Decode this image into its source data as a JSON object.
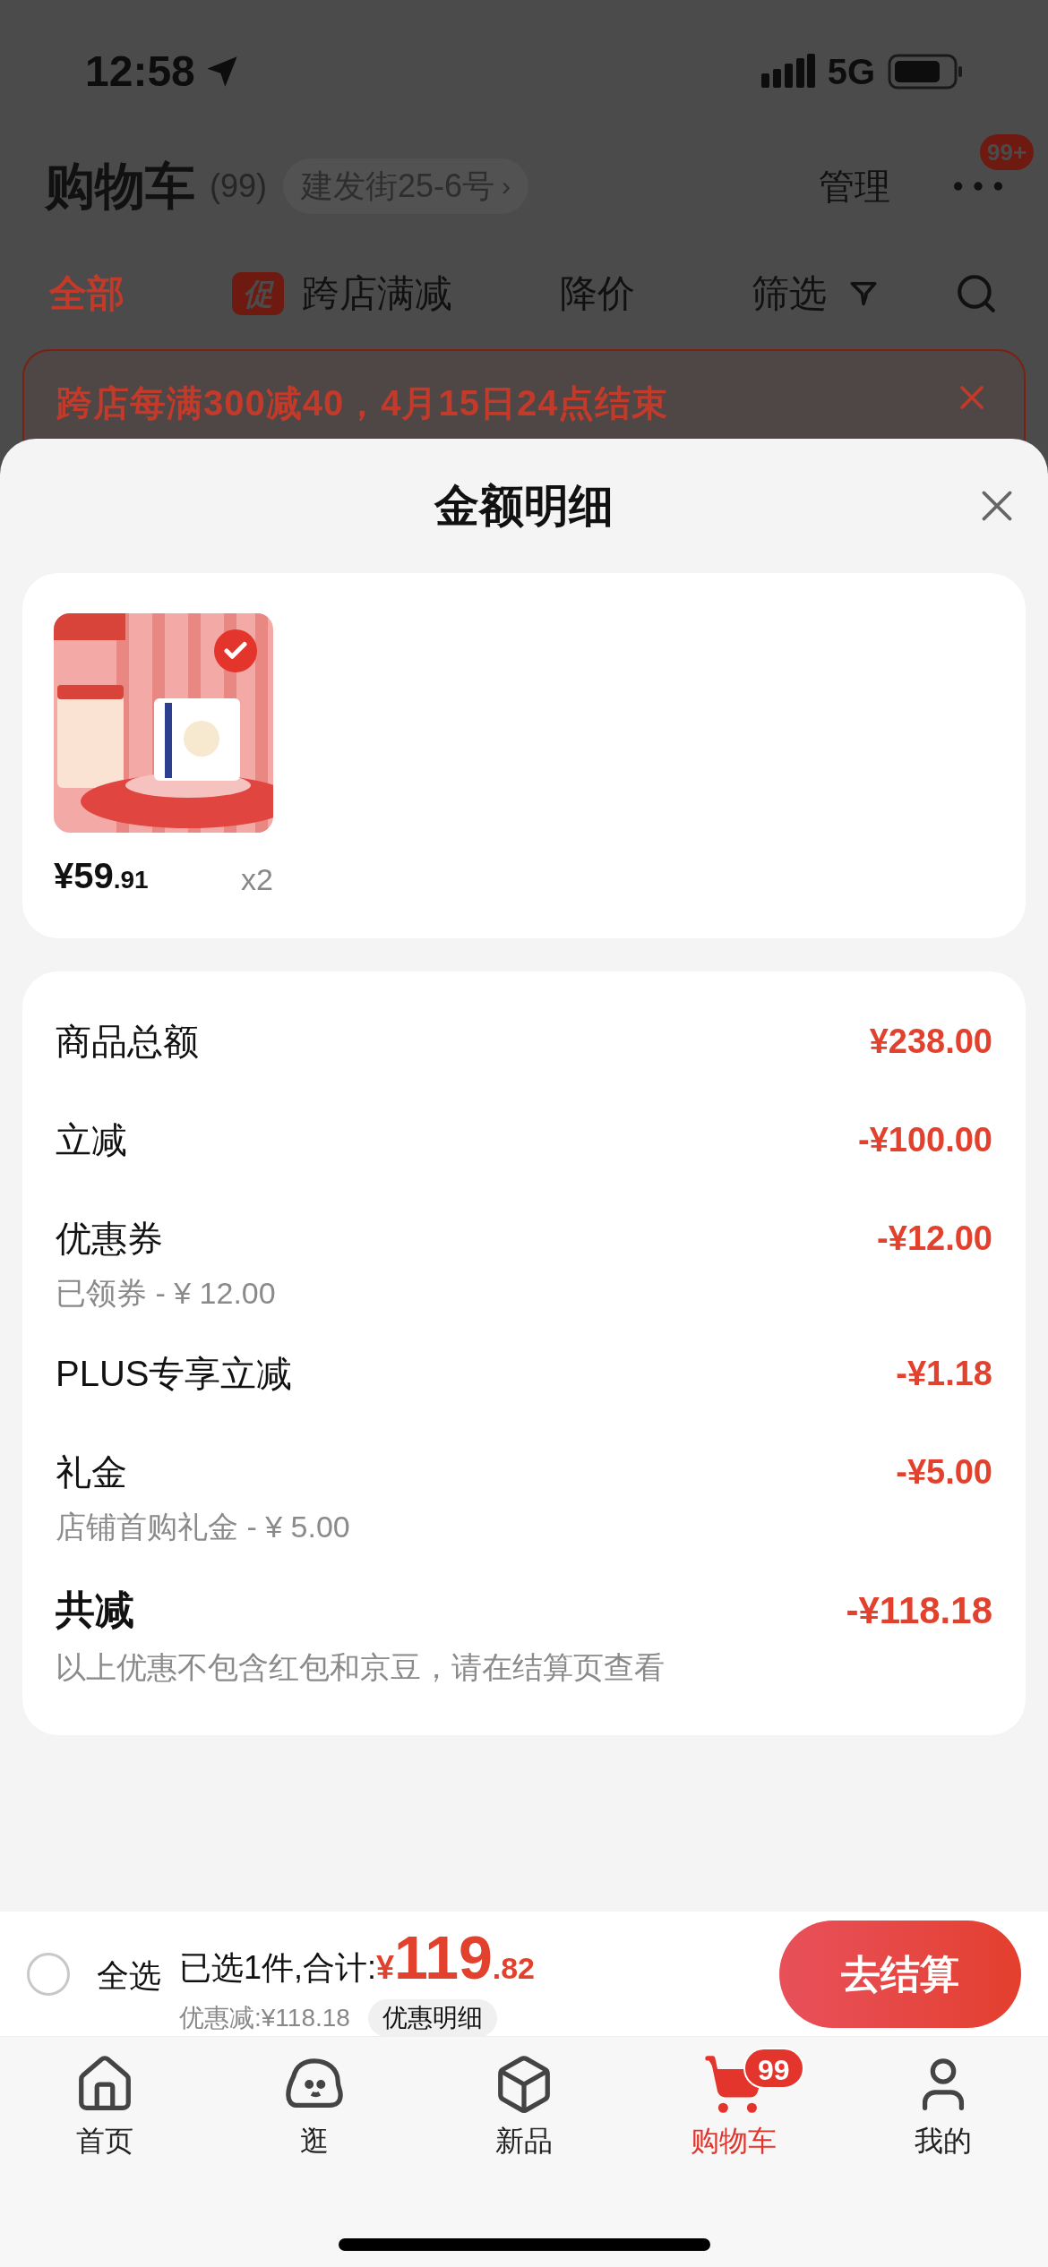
{
  "status_bar": {
    "time": "12:58",
    "network": "5G"
  },
  "header": {
    "title": "购物车",
    "count": "(99)",
    "address": "建发街25-6号",
    "address_arrow": "›",
    "manage": "管理",
    "more_badge": "99+"
  },
  "tabs": [
    {
      "kind": "text",
      "label": "全部",
      "selected": true
    },
    {
      "kind": "promo",
      "tag": "促",
      "label": "跨店满减",
      "selected": false
    },
    {
      "kind": "text",
      "label": "降价",
      "selected": false
    },
    {
      "kind": "filter",
      "label": "筛选",
      "selected": false
    }
  ],
  "banner": {
    "text": "跨店每满300减40，4月15日24点结束"
  },
  "sheet": {
    "title": "金额明细",
    "product": {
      "checked": true,
      "price": "¥59",
      "price_decimal": ".91",
      "quantity": "x2"
    },
    "lines": [
      {
        "kind": "line",
        "label": "商品总额",
        "value": "¥238.00"
      },
      {
        "kind": "line",
        "label": "立减",
        "value": "-¥100.00"
      },
      {
        "kind": "line",
        "label": "优惠券",
        "value": "-¥12.00",
        "note": "已领券 - ¥ 12.00"
      },
      {
        "kind": "line",
        "label": "PLUS专享立减",
        "value": "-¥1.18"
      },
      {
        "kind": "line",
        "label": "礼金",
        "value": "-¥5.00",
        "note": "店铺首购礼金 - ¥ 5.00"
      },
      {
        "kind": "total",
        "label": "共减",
        "value": "-¥118.18",
        "note": "以上优惠不包含红包和京豆，请在结算页查看"
      }
    ]
  },
  "bottom_bar": {
    "select_all": {
      "label": "全选",
      "checked": false
    },
    "summary": "已选1件,合计:",
    "currency": "¥",
    "amount": "119",
    "amount_decimal": ".82",
    "discount": "优惠减:¥118.18",
    "details_button": "优惠明细",
    "checkout": "去结算"
  },
  "nav": [
    {
      "kind": "home",
      "label": "首页",
      "selected": false
    },
    {
      "kind": "browse",
      "label": "逛",
      "selected": false
    },
    {
      "kind": "new",
      "label": "新品",
      "selected": false
    },
    {
      "kind": "cart",
      "label": "购物车",
      "selected": true,
      "badge": "99"
    },
    {
      "kind": "profile",
      "label": "我的",
      "selected": false
    }
  ]
}
